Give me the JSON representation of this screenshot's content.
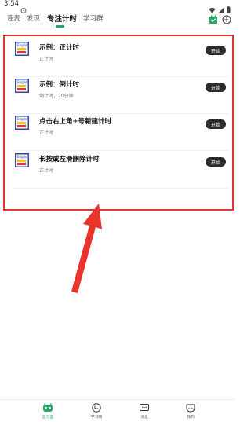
{
  "status_bar": {
    "time": "3:54",
    "icons": [
      "alarm-icon",
      "wifi-icon",
      "signal-icon",
      "battery-icon"
    ]
  },
  "header": {
    "tabs": [
      {
        "label": "连麦",
        "active": false
      },
      {
        "label": "发现",
        "active": false
      },
      {
        "label": "专注计时",
        "active": true
      },
      {
        "label": "学习群",
        "active": false
      }
    ],
    "right_icons": [
      "calendar-check-icon",
      "add-circle-icon"
    ],
    "accent_color": "#25a86a"
  },
  "timers": {
    "items": [
      {
        "title": "示例：正计时",
        "subtitle": "正计时",
        "button": "开始",
        "icon": "english-book-icon"
      },
      {
        "title": "示例：倒计时",
        "subtitle": "倒计时，20分钟",
        "button": "开始",
        "icon": "english-book-icon"
      },
      {
        "title": "点击右上角+号新建计时",
        "subtitle": "正计时",
        "button": "开始",
        "icon": "english-book-icon"
      },
      {
        "title": "长按或左滑删除计时",
        "subtitle": "正计时",
        "button": "开始",
        "icon": "english-book-icon"
      }
    ]
  },
  "annotation": {
    "highlight_color": "#e8342c"
  },
  "bottom_nav": {
    "items": [
      {
        "label": "自习室",
        "icon": "study-room-icon",
        "active": true
      },
      {
        "label": "学习网",
        "icon": "study-net-icon",
        "active": false
      },
      {
        "label": "消息",
        "icon": "message-icon",
        "active": false
      },
      {
        "label": "我的",
        "icon": "profile-icon",
        "active": false
      }
    ]
  }
}
